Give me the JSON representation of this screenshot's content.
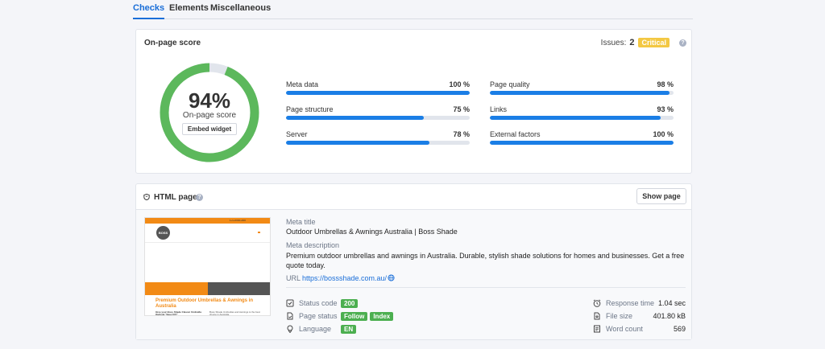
{
  "tabs": [
    {
      "label": "Checks",
      "active": true
    },
    {
      "label": "Elements",
      "active": false
    },
    {
      "label": "Miscellaneous",
      "active": false
    }
  ],
  "onpage": {
    "title": "On-page score",
    "issues_label": "Issues:",
    "issues_count": "2",
    "issues_badge": "Critical",
    "help": "?",
    "score": 94,
    "score_text": "94%",
    "score_label": "On-page score",
    "embed_label": "Embed widget",
    "colors": {
      "gauge": "#5cb85c",
      "gauge_track": "#e1e5ec",
      "bar": "#1a7ee6",
      "critical": "#f3c843"
    },
    "metrics": [
      {
        "name": "Meta data",
        "value": "100 %",
        "pct": 100
      },
      {
        "name": "Page structure",
        "value": "75 %",
        "pct": 75
      },
      {
        "name": "Server",
        "value": "78 %",
        "pct": 78
      },
      {
        "name": "Page quality",
        "value": "98 %",
        "pct": 98
      },
      {
        "name": "Links",
        "value": "93 %",
        "pct": 93
      },
      {
        "name": "External factors",
        "value": "100 %",
        "pct": 100
      }
    ]
  },
  "html_page": {
    "title": "HTML page",
    "show_button": "Show page",
    "meta_title_label": "Meta title",
    "meta_title": "Outdoor Umbrellas & Awnings Australia | Boss Shade",
    "meta_desc_label": "Meta description",
    "meta_desc": "Premium outdoor umbrellas and awnings in Australia. Durable, stylish shade solutions for homes and businesses. Get a free quote today.",
    "url_label": "URL",
    "url": "https://bossshade.com.au/",
    "thumbnail": {
      "top_text": "1+1+0000+000",
      "logo": "BOSS",
      "headline": "Premium Outdoor Umbrellas & Awnings in Australia",
      "sub1": "Give your Boss Shade Classic Umbrella Outlook \"Easy DIY\"",
      "sub2": "Boss Shade Umbrellas and Awnings is the best choice in Australia."
    },
    "status_code_label": "Status code",
    "status_code": "200",
    "page_status_label": "Page status",
    "page_status": [
      "Follow",
      "Index"
    ],
    "language_label": "Language",
    "language": "EN",
    "response_time_label": "Response time",
    "response_time": "1.04 sec",
    "file_size_label": "File size",
    "file_size": "401.80 kB",
    "word_count_label": "Word count",
    "word_count": "569"
  }
}
